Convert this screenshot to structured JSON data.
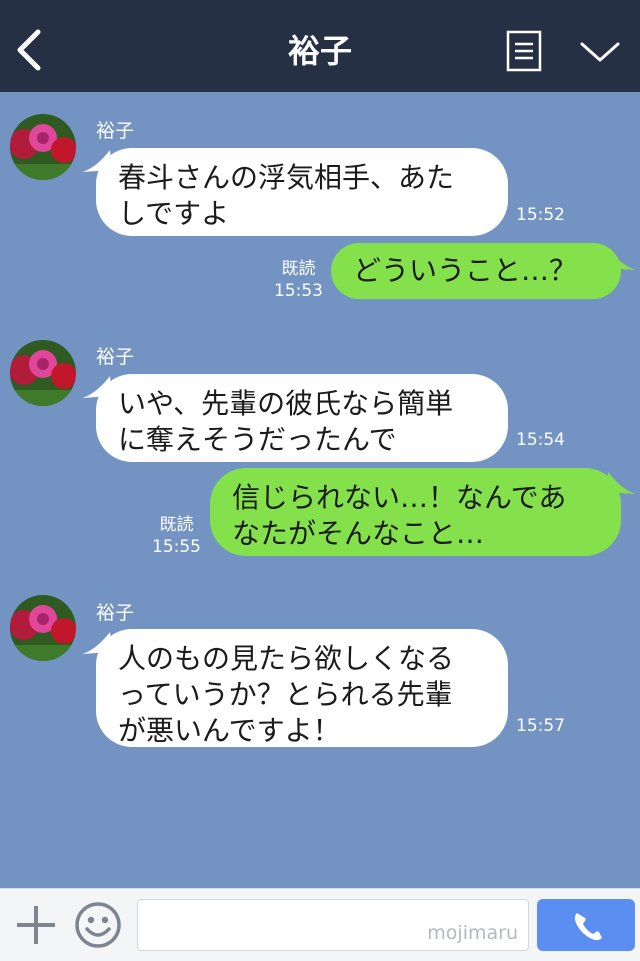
{
  "header": {
    "title": "裕子",
    "back_icon": "chevron-left-icon",
    "menu_icon": "note-icon",
    "dropdown_icon": "chevron-down-icon"
  },
  "messages": [
    {
      "direction": "in",
      "sender": "裕子",
      "lines": [
        "春斗さんの浮気相手、あた",
        "しですよ"
      ],
      "time": "15:52"
    },
    {
      "direction": "out",
      "read": "既読",
      "lines": [
        "どういうこと…？"
      ],
      "time": "15:53"
    },
    {
      "direction": "in",
      "sender": "裕子",
      "lines": [
        "いや、先輩の彼氏なら簡単",
        "に奪えそうだったんで"
      ],
      "time": "15:54"
    },
    {
      "direction": "out",
      "read": "既読",
      "lines": [
        "信じられない…！なんであ",
        "なたがそんなこと…"
      ],
      "time": "15:55"
    },
    {
      "direction": "in",
      "sender": "裕子",
      "lines": [
        "人のもの見たら欲しくなる",
        "っていうか？とられる先輩",
        "が悪いんですよ！"
      ],
      "time": "15:57"
    }
  ],
  "input_bar": {
    "plus_icon": "plus-icon",
    "emoji_icon": "smiley-icon",
    "watermark": "mojimaru",
    "call_icon": "phone-icon"
  },
  "colors": {
    "header_bg": "#253044",
    "chat_bg": "#7393c2",
    "incoming_bubble": "#ffffff",
    "outgoing_bubble": "#84e14c",
    "call_button": "#5a8ef0"
  }
}
